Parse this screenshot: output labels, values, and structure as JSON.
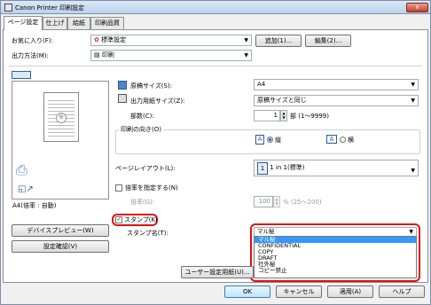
{
  "window": {
    "title": "Canon Printer 印刷設定",
    "close_label": "x"
  },
  "tabs": [
    "ページ設定",
    "仕上げ",
    "給紙",
    "印刷品質"
  ],
  "profile": {
    "label": "お気に入り(F):",
    "value": "標準設定",
    "add_button": "追加(1)...",
    "edit_button": "編集(2)..."
  },
  "output": {
    "label": "出力方法(M):",
    "value": "印刷"
  },
  "page": {
    "original_size_label": "原稿サイズ(S):",
    "original_size_value": "A4",
    "output_size_label": "出力用紙サイズ(Z):",
    "output_size_value": "原稿サイズと同じ",
    "copies_label": "部数(C):",
    "copies_value": "1",
    "copies_range": "部 (1〜9999)",
    "orientation_label": "印刷の向き(O)",
    "portrait_label": "縦",
    "landscape_label": "横",
    "layout_label": "ページレイアウト(L):",
    "layout_value": "1 in 1(標準)",
    "scaling_label": "倍率を指定する(N)",
    "scale_label": "倍率(G):",
    "scale_value": "100",
    "scale_range": "% (25〜200)"
  },
  "preview": {
    "caption": "A4(倍率 : 自動)"
  },
  "stamp": {
    "checkbox_label": "スタンプ(K)",
    "name_label": "スタンプ名(T):",
    "selected": "マル秘",
    "options": [
      "マル秘",
      "CONFIDENTIAL",
      "COPY",
      "DRAFT",
      "社外秘",
      "コピー禁止"
    ],
    "highlight_color": "#e01010"
  },
  "buttons": {
    "device_preview": "デバイスプレビュー(W)",
    "settings_check": "設定確認(V)",
    "user_paper": "ユーザー設定用紙(U)...",
    "ok": "OK",
    "cancel": "キャンセル",
    "apply": "適用(A)",
    "help": "ヘルプ"
  }
}
